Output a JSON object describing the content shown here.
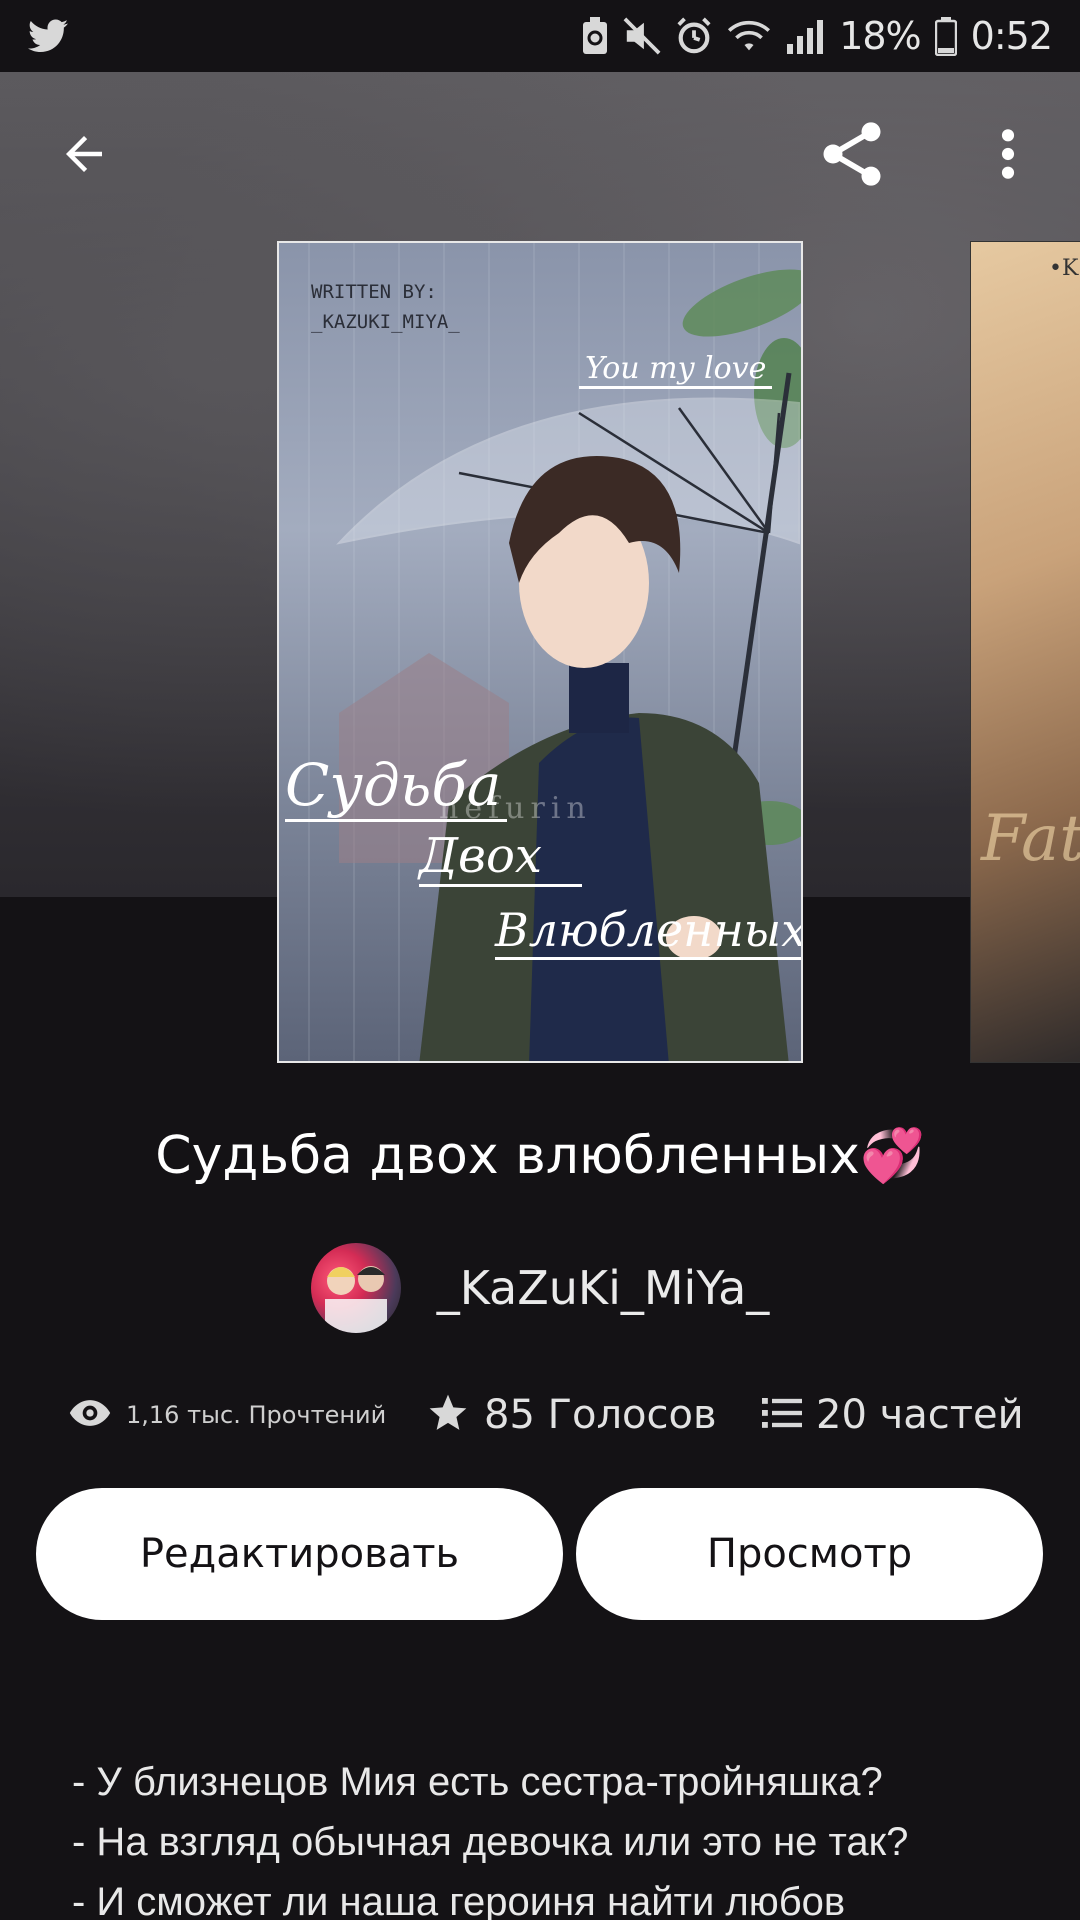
{
  "status_bar": {
    "battery_percent": "18%",
    "time": "0:52",
    "icons": [
      "twitter-icon",
      "battery-saver-icon",
      "mute-icon",
      "alarm-icon",
      "wifi-icon",
      "signal-icon",
      "battery-icon"
    ]
  },
  "toolbar": {
    "back_icon": "arrow-left-icon",
    "share_icon": "share-icon",
    "more_icon": "more-vertical-icon"
  },
  "cover": {
    "written_by": "WRITTEN BY:",
    "author_tag": "_KAZUKI_MIYA_",
    "tagline": "You my love",
    "title_line1": "Судьба",
    "title_line2": "Двох",
    "title_line3": "Влюбленных",
    "watermark": "nefurin"
  },
  "next_cover": {
    "corner_text": "•K",
    "title_fragment": "Fate"
  },
  "book": {
    "title": "Судьба двох влюбленных💞",
    "author": "_KaZuKi_MiYa_"
  },
  "stats": {
    "reads": "1,16 тыс. Прочтений",
    "votes": "85 Голосов",
    "parts": "20 частей"
  },
  "actions": {
    "edit_label": "Редактировать",
    "preview_label": "Просмотр"
  },
  "description": {
    "lines": [
      "- У близнецов Мия есть сестра-тройняшка?",
      "- На взгляд обычная девочка или это не так?",
      "- И сможет ли наша героиня найти любов"
    ]
  },
  "colors": {
    "background": "#141215",
    "button_bg": "#ffffff",
    "button_text": "#141215"
  }
}
